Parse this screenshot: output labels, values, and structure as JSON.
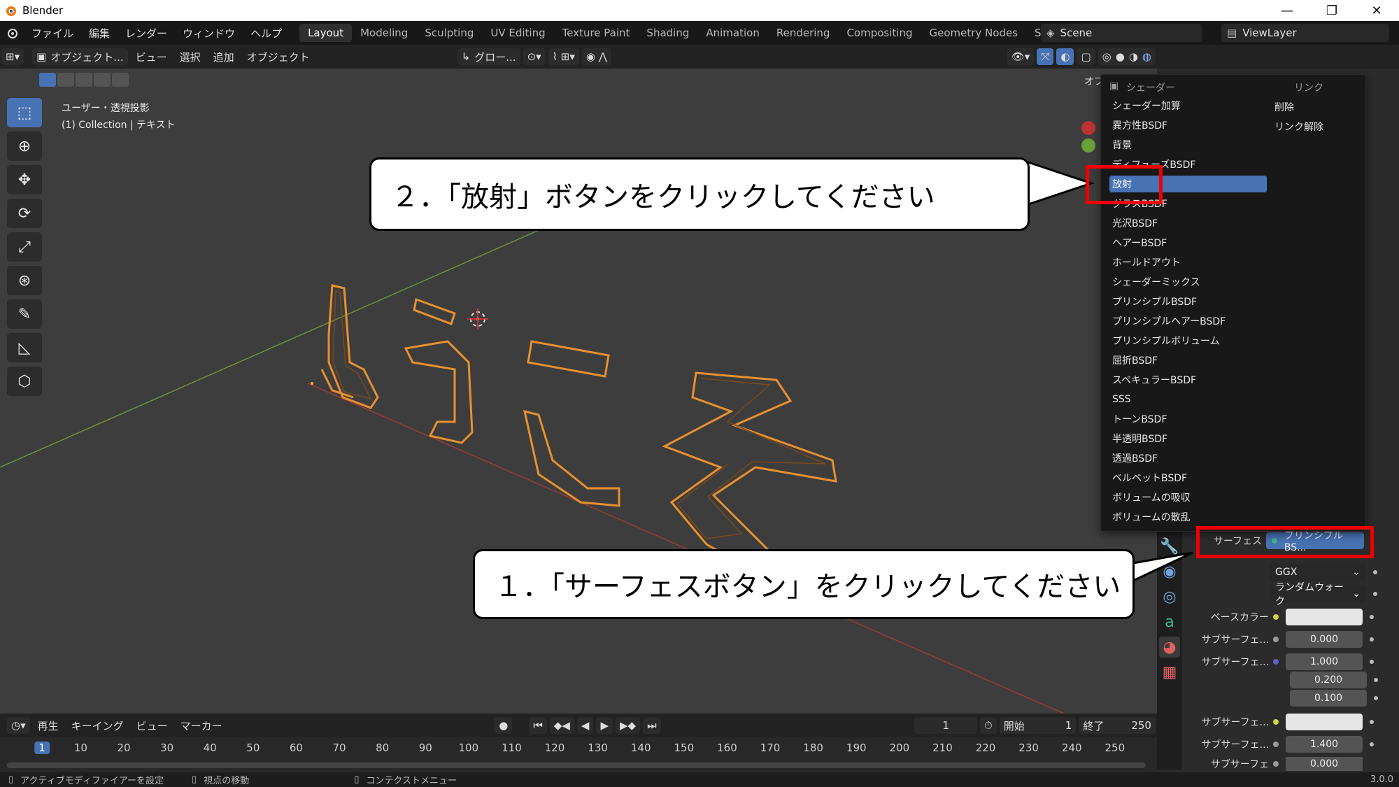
{
  "window": {
    "title": "Blender",
    "minimize": "—",
    "restore": "❐",
    "close": "✕"
  },
  "menubar": [
    "ファイル",
    "編集",
    "レンダー",
    "ウィンドウ",
    "ヘルプ"
  ],
  "workspaces": [
    "Layout",
    "Modeling",
    "Sculpting",
    "UV Editing",
    "Texture Paint",
    "Shading",
    "Animation",
    "Rendering",
    "Compositing",
    "Geometry Nodes",
    "Scripting"
  ],
  "scene": "Scene",
  "viewlayer": "ViewLayer",
  "viewport_header": {
    "mode": "オブジェクト...",
    "menus": [
      "ビュー",
      "選択",
      "追加",
      "オブジェクト"
    ],
    "transform": "グロー..."
  },
  "viewport": {
    "info_line1": "ユーザー・透視投影",
    "info_line2": "(1) Collection | テキスト",
    "text_object": "ようこそ",
    "partial_label": "オブ"
  },
  "shader_menu": {
    "header_left": "シェーダー",
    "header_right": "リンク",
    "items": [
      "シェーダー加算",
      "異方性BSDF",
      "背景",
      "ディフューズBSDF",
      "放射",
      "グラスBSDF",
      "光沢BSDF",
      "ヘアーBSDF",
      "ホールドアウト",
      "シェーダーミックス",
      "プリンシプルBSDF",
      "プリンシプルヘアーBSDF",
      "プリンシプルボリューム",
      "屈折BSDF",
      "スペキュラーBSDF",
      "SSS",
      "トーンBSDF",
      "半透明BSDF",
      "透過BSDF",
      "ベルベットBSDF",
      "ボリュームの吸収",
      "ボリュームの散乱"
    ],
    "link_items": [
      "削除",
      "リンク解除"
    ],
    "highlighted": "放射"
  },
  "properties": {
    "surface_label": "サーフェス",
    "surface_value": "プリンシプルBS...",
    "distribution": "GGX",
    "subsurface_method": "ランダムウォーク",
    "rows": [
      {
        "label": "ベースカラー",
        "value": ""
      },
      {
        "label": "サブサーフェ...",
        "value": "0.000"
      },
      {
        "label": "サブサーフェ...",
        "value": "1.000"
      },
      {
        "label": "",
        "value": "0.200"
      },
      {
        "label": "",
        "value": "0.100"
      },
      {
        "label": "サブサーフェ...",
        "value": ""
      },
      {
        "label": "サブサーフェ...",
        "value": "1.400"
      },
      {
        "label": "サブサーフェ",
        "value": "0.000"
      }
    ]
  },
  "callouts": {
    "step1": "１．「サーフェスボタン」をクリックしてください",
    "step2": "２．「放射」ボタンをクリックしてください"
  },
  "timeline": {
    "menus": [
      "再生",
      "キーイング",
      "ビュー",
      "マーカー"
    ],
    "current_frame": "1",
    "start_label": "開始",
    "start_value": "1",
    "end_label": "終了",
    "end_value": "250",
    "ticks": [
      "1",
      "10",
      "20",
      "30",
      "40",
      "50",
      "60",
      "70",
      "80",
      "90",
      "100",
      "110",
      "120",
      "130",
      "140",
      "150",
      "160",
      "170",
      "180",
      "190",
      "200",
      "210",
      "220",
      "230",
      "240",
      "250"
    ]
  },
  "statusbar": {
    "left": "アクティブモディファイアーを設定",
    "middle": "視点の移動",
    "right": "コンテクストメニュー",
    "version": "3.0.0"
  },
  "colors": {
    "accent": "#4772b3",
    "callout_border": "#e00000",
    "text_outline": "#e8902f"
  }
}
